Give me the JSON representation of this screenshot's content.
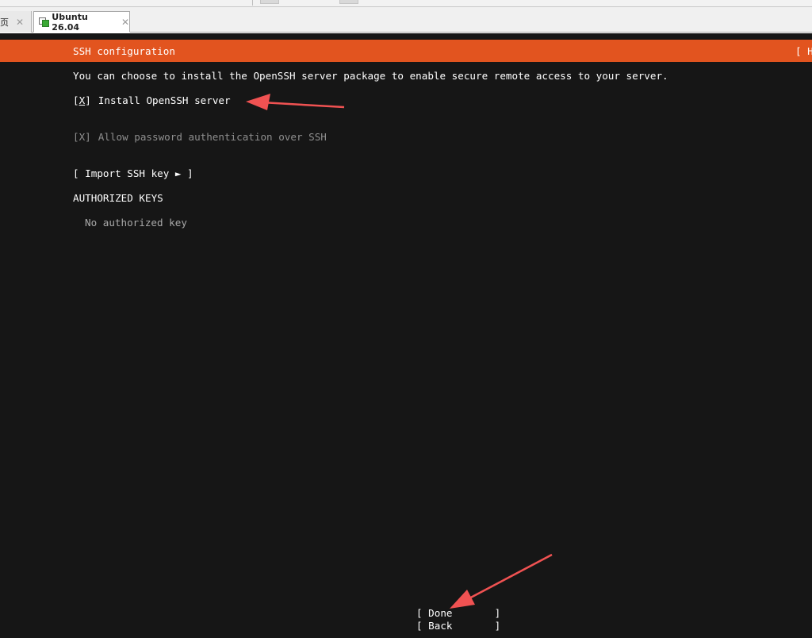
{
  "window": {
    "home_tab": {
      "label": "页",
      "close": "✕"
    },
    "active_tab": {
      "label": "Ubuntu 26.04",
      "close": "✕"
    }
  },
  "installer": {
    "header": {
      "title": "SSH configuration",
      "help": "[ H"
    },
    "intro": "You can choose to install the OpenSSH server package to enable secure remote access to your server.",
    "install_openssh": {
      "box_open": "[",
      "mark": "X",
      "box_close": "]",
      "label": "Install OpenSSH server",
      "checked": true
    },
    "allow_password": {
      "checkbox": "[X]",
      "label": "Allow password authentication over SSH",
      "checked": true,
      "enabled": false
    },
    "import_key": "[ Import SSH key ► ]",
    "authorized_keys_heading": "AUTHORIZED KEYS",
    "no_keys": "No authorized key",
    "buttons": {
      "done": "[ Done       ]",
      "back": "[ Back       ]"
    }
  },
  "colors": {
    "header_bar": "#e2541f",
    "terminal_bg": "#161616",
    "annotation_arrow": "#f05252"
  }
}
